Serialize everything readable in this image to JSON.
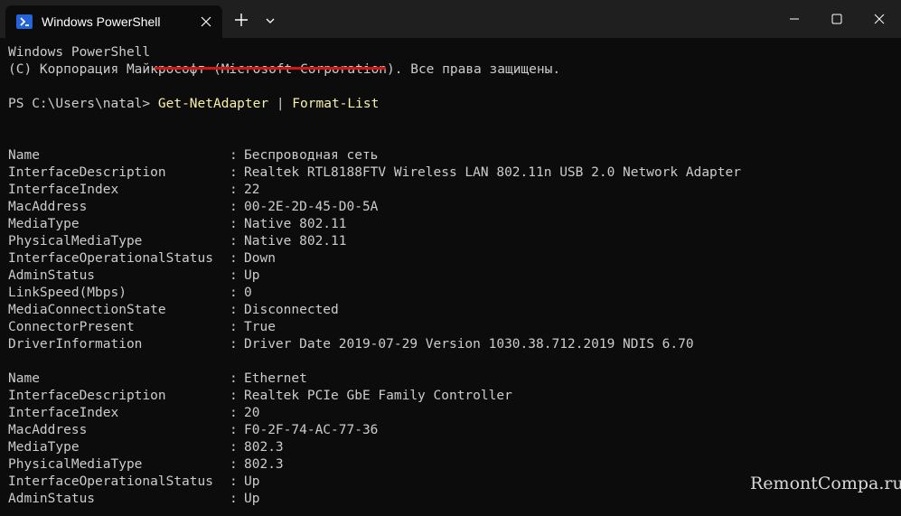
{
  "window": {
    "tab_title": "Windows PowerShell",
    "tab_icon": "powershell-icon",
    "controls": [
      "minimize-icon",
      "maximize-icon",
      "close-icon"
    ]
  },
  "terminal": {
    "header_line1": "Windows PowerShell",
    "header_line2": "(C) Корпорация Майкрософт (Microsoft Corporation). Все права защищены.",
    "prompt": "PS C:\\Users\\natal> ",
    "command_part1": "Get-NetAdapter",
    "command_pipe": " | ",
    "command_part2": "Format-List",
    "separator": ": ",
    "adapters": [
      {
        "fields": [
          {
            "key": "Name",
            "value": "Беспроводная сеть"
          },
          {
            "key": "InterfaceDescription",
            "value": "Realtek RTL8188FTV Wireless LAN 802.11n USB 2.0 Network Adapter"
          },
          {
            "key": "InterfaceIndex",
            "value": "22"
          },
          {
            "key": "MacAddress",
            "value": "00-2E-2D-45-D0-5A"
          },
          {
            "key": "MediaType",
            "value": "Native 802.11"
          },
          {
            "key": "PhysicalMediaType",
            "value": "Native 802.11"
          },
          {
            "key": "InterfaceOperationalStatus",
            "value": "Down"
          },
          {
            "key": "AdminStatus",
            "value": "Up"
          },
          {
            "key": "LinkSpeed(Mbps)",
            "value": "0"
          },
          {
            "key": "MediaConnectionState",
            "value": "Disconnected"
          },
          {
            "key": "ConnectorPresent",
            "value": "True"
          },
          {
            "key": "DriverInformation",
            "value": "Driver Date 2019-07-29 Version 1030.38.712.2019 NDIS 6.70"
          }
        ]
      },
      {
        "fields": [
          {
            "key": "Name",
            "value": "Ethernet"
          },
          {
            "key": "InterfaceDescription",
            "value": "Realtek PCIe GbE Family Controller"
          },
          {
            "key": "InterfaceIndex",
            "value": "20"
          },
          {
            "key": "MacAddress",
            "value": "F0-2F-74-AC-77-36"
          },
          {
            "key": "MediaType",
            "value": "802.3"
          },
          {
            "key": "PhysicalMediaType",
            "value": "802.3"
          },
          {
            "key": "InterfaceOperationalStatus",
            "value": "Up"
          },
          {
            "key": "AdminStatus",
            "value": "Up"
          }
        ]
      }
    ]
  },
  "watermark": "RemontCompa.ru"
}
